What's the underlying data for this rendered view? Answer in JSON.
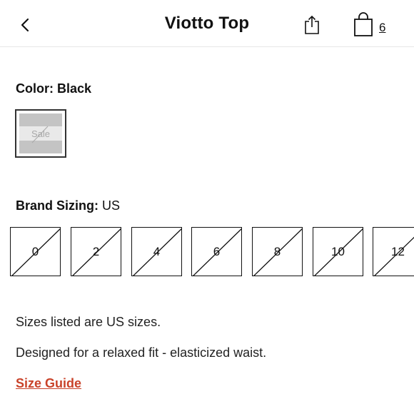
{
  "header": {
    "title": "Viotto Top",
    "bag_count": "6",
    "back_icon": "chevron-left-icon",
    "share_icon": "share-icon",
    "bag_icon": "shopping-bag-icon"
  },
  "color": {
    "label": "Color:",
    "value": "Black",
    "swatch_text": "Sale"
  },
  "sizing": {
    "label": "Brand Sizing:",
    "value": "US",
    "sizes": [
      "0",
      "2",
      "4",
      "6",
      "8",
      "10",
      "12"
    ]
  },
  "notes": {
    "line1": "Sizes listed are US sizes.",
    "line2": "Designed for a relaxed fit - elasticized waist."
  },
  "size_guide_label": "Size Guide",
  "colors": {
    "accent": "#c9432a",
    "text": "#111111",
    "swatch_gray": "#c4c4c4"
  }
}
